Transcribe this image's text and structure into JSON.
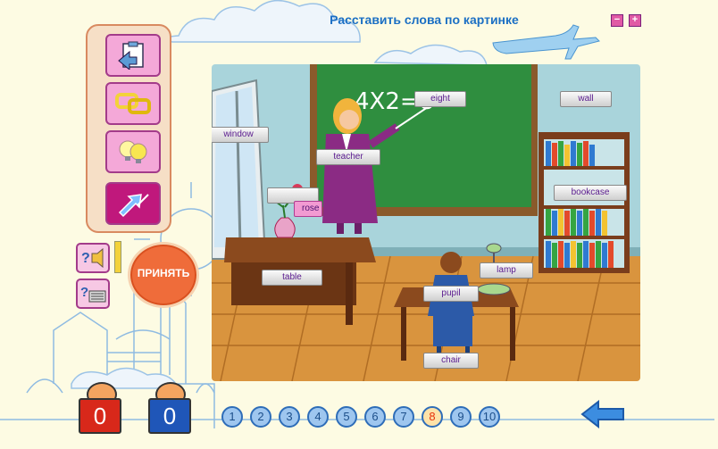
{
  "header": {
    "title": "Расставить слова по картинке",
    "minimize_label": "−",
    "maximize_label": "+"
  },
  "tools": [
    {
      "name": "clipboard-tool",
      "icon": "clipboard-icon"
    },
    {
      "name": "links-tool",
      "icon": "chain-icon"
    },
    {
      "name": "hint-tool",
      "icon": "lightbulb-icon"
    },
    {
      "name": "swap-tool",
      "icon": "swap-arrows-icon",
      "selected": true
    }
  ],
  "side_buttons": [
    {
      "icon": "help-speaker-icon"
    },
    {
      "icon": "help-keyboard-icon"
    }
  ],
  "accept_button": {
    "label": "ПРИНЯТЬ"
  },
  "word_tags": {
    "eight": "eight",
    "wall": "wall",
    "window": "window",
    "teacher": "teacher",
    "bookcase": "bookcase",
    "rose": "rose",
    "lamp": "lamp",
    "table": "table",
    "pupil": "pupil",
    "chair": "chair"
  },
  "blackboard_text": "4X2=8",
  "scores": {
    "correct": "0",
    "wrong": "0",
    "correct_color": "#d8281a",
    "wrong_color": "#1f56b8"
  },
  "pages": {
    "items": [
      "1",
      "2",
      "3",
      "4",
      "5",
      "6",
      "7",
      "8",
      "9",
      "10"
    ],
    "current": "8"
  },
  "colors": {
    "accent": "#1b6fc4",
    "panel": "#f6dfc6",
    "tool_button": "#f4a8d8",
    "accept": "#ef6c3a"
  }
}
